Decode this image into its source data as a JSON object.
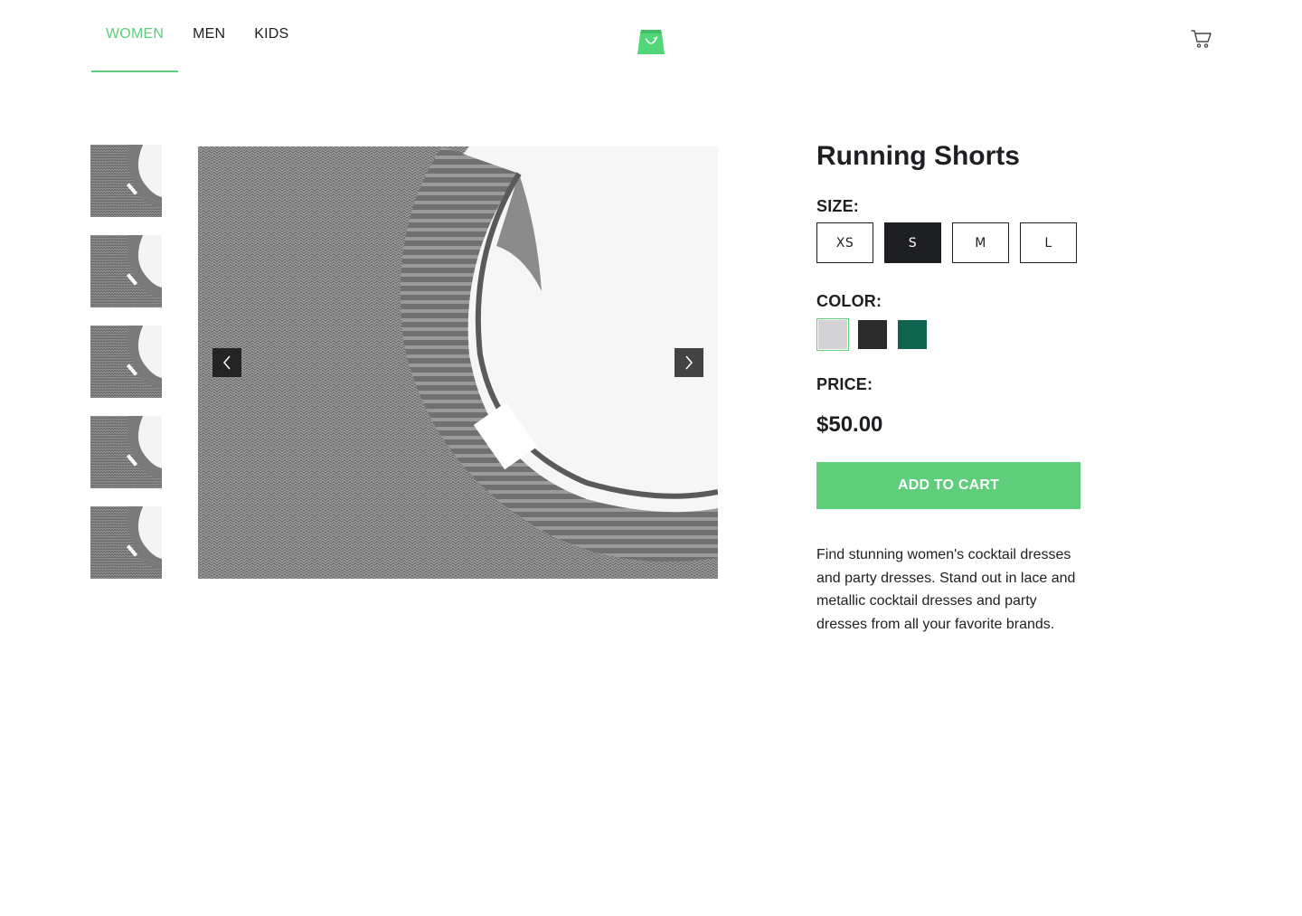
{
  "header": {
    "nav": [
      {
        "label": "WOMEN",
        "active": true
      },
      {
        "label": "MEN",
        "active": false
      },
      {
        "label": "KIDS",
        "active": false
      }
    ],
    "logo_icon": "green-shopping-bag-icon",
    "cart_icon": "cart-icon"
  },
  "gallery": {
    "thumbnail_count": 5,
    "main_image": "grey knit sweater collar close-up",
    "prev_icon": "chevron-left-icon",
    "next_icon": "chevron-right-icon"
  },
  "product": {
    "title": "Running Shorts",
    "size_label": "SIZE:",
    "sizes": [
      {
        "label": "XS",
        "selected": false
      },
      {
        "label": "S",
        "selected": true
      },
      {
        "label": "M",
        "selected": false
      },
      {
        "label": "L",
        "selected": false
      }
    ],
    "color_label": "COLOR:",
    "colors": [
      {
        "hex": "#d3d2d5",
        "selected": true
      },
      {
        "hex": "#2b2b2b",
        "selected": false
      },
      {
        "hex": "#0f6450",
        "selected": false
      }
    ],
    "price_label": "PRICE:",
    "price": "$50.00",
    "add_to_cart": "ADD TO CART",
    "description": "Find stunning women's cocktail dresses and party dresses. Stand out in lace and metallic cocktail dresses and party dresses from all your favorite brands."
  },
  "theme": {
    "accent": "#5ece7b",
    "text": "#1d1f22"
  }
}
